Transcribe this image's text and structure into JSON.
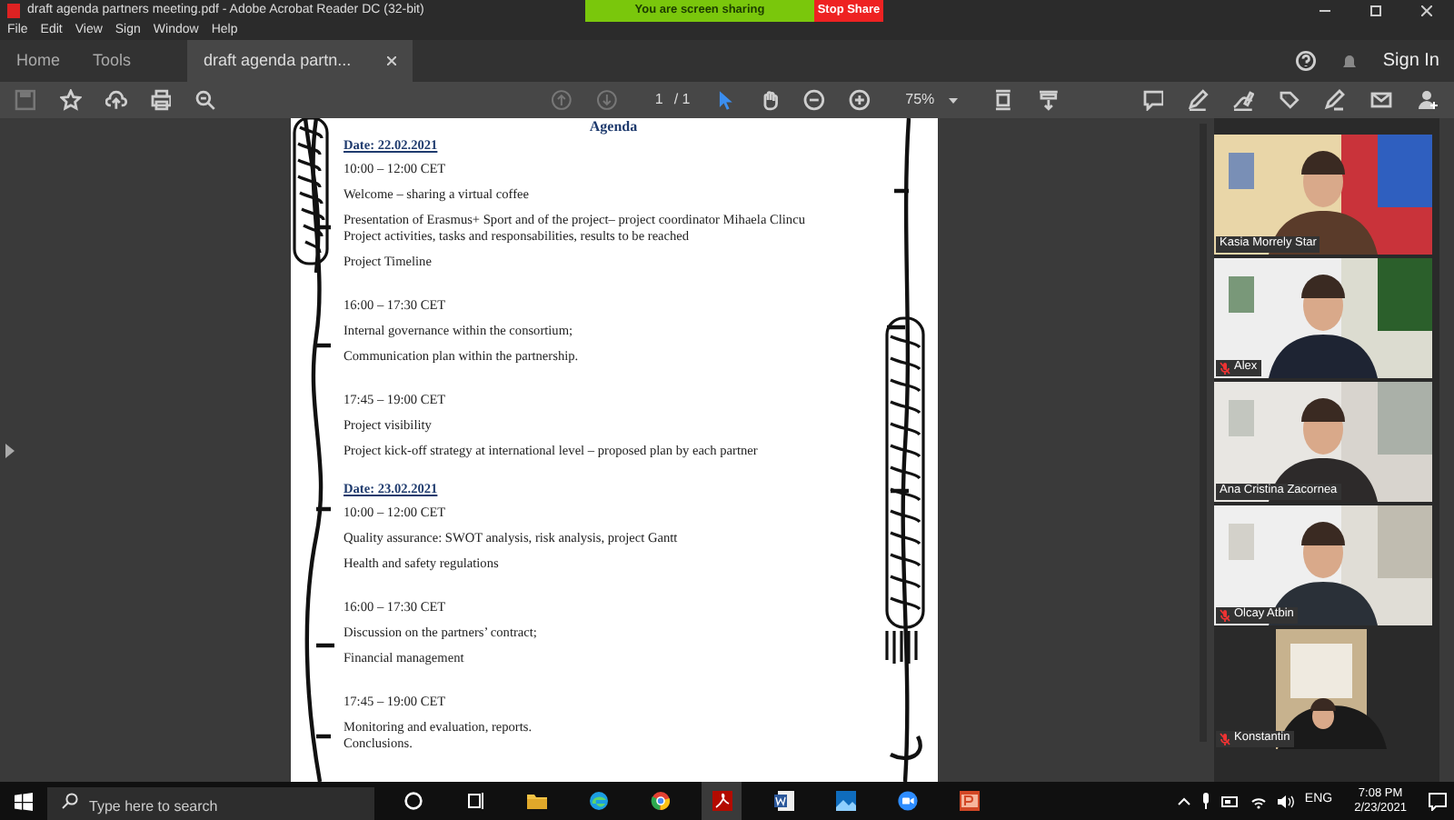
{
  "window": {
    "title": "draft agenda partners meeting.pdf - Adobe Acrobat Reader DC (32-bit)"
  },
  "sharing_banner": {
    "status": "You are screen sharing",
    "stop_button": "Stop Share"
  },
  "menu": [
    "File",
    "Edit",
    "View",
    "Sign",
    "Window",
    "Help"
  ],
  "tabs": [
    {
      "label": "Home",
      "selected": false,
      "closable": false
    },
    {
      "label": "Tools",
      "selected": false,
      "closable": false
    },
    {
      "label": "draft agenda partn...",
      "selected": true,
      "closable": true
    }
  ],
  "sign_in": "Sign In",
  "toolbar": {
    "page_current": "1",
    "page_total": "/ 1",
    "zoom": "75%"
  },
  "document": {
    "heading": "Agenda",
    "days": [
      {
        "date": "Date: 22.02.2021",
        "sessions": [
          {
            "time": "10:00 – 12:00 CET",
            "items": [
              [
                "Welcome – sharing a virtual coffee"
              ],
              [
                "Presentation of Erasmus+ Sport and of the project– project coordinator Mihaela Clincu",
                "Project activities, tasks and responsabilities, results to be reached"
              ],
              [
                "Project Timeline"
              ]
            ]
          },
          {
            "time": "16:00 – 17:30 CET",
            "items": [
              [
                "Internal governance within the consortium;"
              ],
              [
                "Communication plan within the partnership."
              ]
            ]
          },
          {
            "time": "17:45 – 19:00 CET",
            "items": [
              [
                "Project visibility"
              ],
              [
                "Project kick-off strategy at international level – proposed plan by each partner"
              ]
            ]
          }
        ]
      },
      {
        "date": "Date: 23.02.2021",
        "sessions": [
          {
            "time": "10:00 – 12:00 CET",
            "items": [
              [
                "Quality assurance: SWOT analysis, risk analysis, project Gantt"
              ],
              [
                "Health and safety regulations"
              ]
            ]
          },
          {
            "time": "16:00 – 17:30 CET",
            "items": [
              [
                "Discussion on the partners’ contract;"
              ],
              [
                "Financial management"
              ]
            ]
          },
          {
            "time": "17:45 – 19:00 CET",
            "items": [
              [
                "Monitoring and evaluation, reports.",
                "Conclusions."
              ]
            ]
          }
        ]
      }
    ]
  },
  "participants": [
    {
      "name": "Kasia Morrely Star",
      "muted": false,
      "kind": "picture"
    },
    {
      "name": "Alex",
      "muted": true,
      "kind": "picture"
    },
    {
      "name": "Ana Cristina Zacornea",
      "muted": false,
      "kind": "picture"
    },
    {
      "name": "Olcay Atbin",
      "muted": true,
      "kind": "picture"
    },
    {
      "name": "Konstantin",
      "muted": true,
      "kind": "picture"
    }
  ],
  "taskbar": {
    "search_placeholder": "Type here to search",
    "language": "ENG",
    "time": "7:08 PM",
    "date": "2/23/2021"
  }
}
